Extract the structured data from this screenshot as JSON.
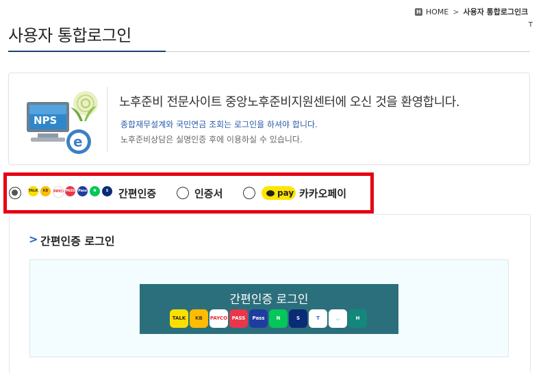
{
  "breadcrumb": {
    "home_icon": "H",
    "home": "HOME",
    "separator": ">",
    "current": "사용자 통합로그인크"
  },
  "corner_mark": "T",
  "page_title": "사용자 통합로그인",
  "welcome": {
    "logo_text": "NPS",
    "main": "노후준비 전문사이트 중앙노후준비지원센터에 오신 것을 환영합니다.",
    "sub1": "종합재무설계와 국민연금 조회는 로그인을 하셔야 합니다.",
    "sub2": "노후준비상담은 실명인증 후에 이용하실 수 있습니다."
  },
  "login_methods": {
    "options": [
      {
        "label": "간편인증",
        "selected": true
      },
      {
        "label": "인증서",
        "selected": false
      },
      {
        "label": "카카오페이",
        "selected": false
      }
    ],
    "mini_icons": [
      {
        "name": "kakao-talk-icon",
        "text": "TALK",
        "bg": "#f9e000",
        "fg": "#3c1e1e"
      },
      {
        "name": "kb-icon",
        "text": "KB",
        "bg": "#ffbc00",
        "fg": "#4a3a2a"
      },
      {
        "name": "payco-icon",
        "text": "PAYCO",
        "bg": "#ffffff",
        "fg": "#e8272c"
      },
      {
        "name": "pass-icon",
        "text": "PASS",
        "bg": "#e8364a",
        "fg": "#ffffff"
      },
      {
        "name": "samsung-pass-icon",
        "text": "Pass",
        "bg": "#1f3ca0",
        "fg": "#ffffff"
      },
      {
        "name": "naver-icon",
        "text": "N",
        "bg": "#03c75a",
        "fg": "#ffffff"
      },
      {
        "name": "shinhan-icon",
        "text": "S",
        "bg": "#0a2c76",
        "fg": "#ffffff"
      }
    ],
    "kakaopay_badge": "pay"
  },
  "section": {
    "arrow": ">",
    "title": "간편인증 로그인"
  },
  "login_button": {
    "label": "간편인증 로그인",
    "icons": [
      {
        "name": "kakao-talk-icon",
        "text": "TALK",
        "bg": "#f9e000",
        "fg": "#3c1e1e"
      },
      {
        "name": "kb-icon",
        "text": "KB",
        "bg": "#ffbc00",
        "fg": "#4a3a2a"
      },
      {
        "name": "payco-icon",
        "text": "PAYCO",
        "bg": "#ffffff",
        "fg": "#e8272c"
      },
      {
        "name": "pass-icon",
        "text": "PASS",
        "bg": "#e8364a",
        "fg": "#ffffff"
      },
      {
        "name": "samsung-pass-icon",
        "text": "Pass",
        "bg": "#1f3ca0",
        "fg": "#ffffff"
      },
      {
        "name": "naver-icon",
        "text": "N",
        "bg": "#03c75a",
        "fg": "#ffffff"
      },
      {
        "name": "shinhan-icon",
        "text": "S",
        "bg": "#0a2c76",
        "fg": "#ffffff"
      },
      {
        "name": "toss-icon",
        "text": "T",
        "bg": "#ffffff",
        "fg": "#1b64da"
      },
      {
        "name": "banksalad-icon",
        "text": "◡",
        "bg": "#ffffff",
        "fg": "#1aa57a"
      },
      {
        "name": "hana-icon",
        "text": "H",
        "bg": "#13877a",
        "fg": "#ffffff"
      }
    ]
  },
  "colors": {
    "accent_red": "#e60012",
    "button_teal": "#2b6f7c",
    "title_navy": "#1d3f72"
  }
}
